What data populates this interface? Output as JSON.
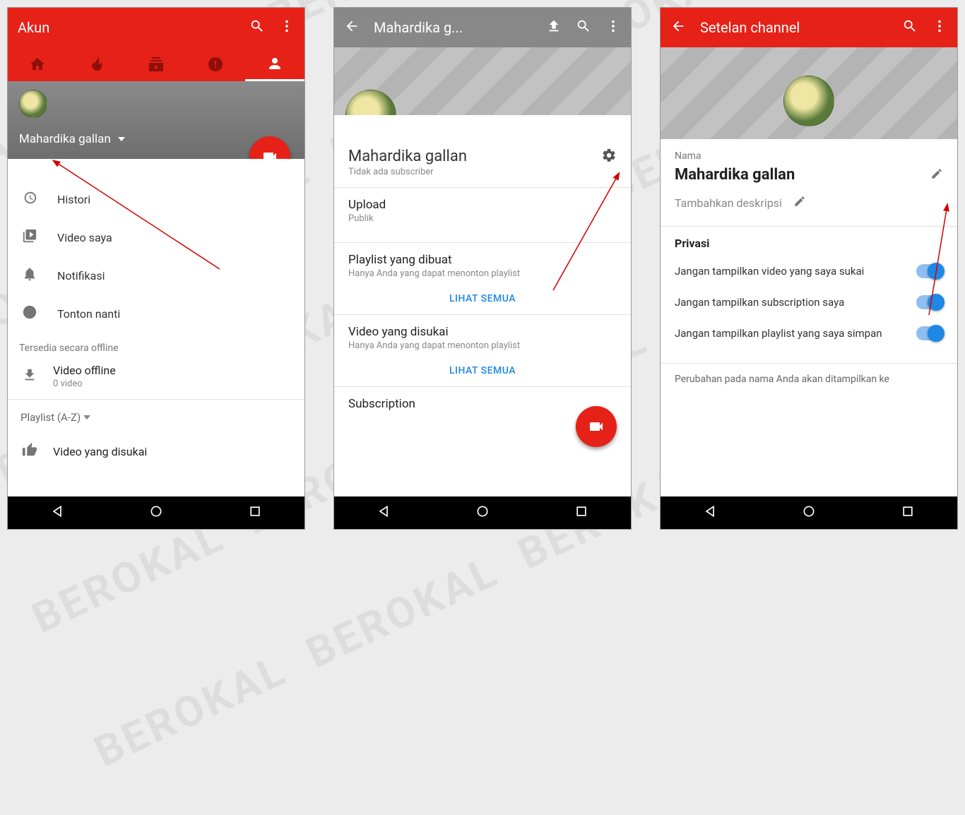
{
  "watermark": "BEROKAL",
  "phone1": {
    "title": "Akun",
    "username": "Mahardika gallan",
    "menu": [
      "Histori",
      "Video saya",
      "Notifikasi",
      "Tonton nanti"
    ],
    "offline_section": "Tersedia secara offline",
    "offline_title": "Video offline",
    "offline_sub": "0 video",
    "playlist_header": "Playlist (A-Z)",
    "liked": "Video yang disukai"
  },
  "phone2": {
    "title": "Mahardika g...",
    "channel_name": "Mahardika gallan",
    "subscriber": "Tidak ada subscriber",
    "upload_title": "Upload",
    "upload_sub": "Publik",
    "playlist_title": "Playlist yang dibuat",
    "playlist_sub": "Hanya Anda yang dapat menonton playlist",
    "see_all": "LIHAT SEMUA",
    "liked_title": "Video yang disukai",
    "liked_sub": "Hanya Anda yang dapat menonton playlist",
    "subscription": "Subscription"
  },
  "phone3": {
    "title": "Setelan channel",
    "name_label": "Nama",
    "name_value": "Mahardika gallan",
    "desc_placeholder": "Tambahkan deskripsi",
    "privacy_title": "Privasi",
    "priv": [
      "Jangan tampilkan video yang saya sukai",
      "Jangan tampilkan subscription saya",
      "Jangan tampilkan playlist yang saya simpan"
    ],
    "note": "Perubahan pada nama Anda akan ditampilkan ke"
  }
}
